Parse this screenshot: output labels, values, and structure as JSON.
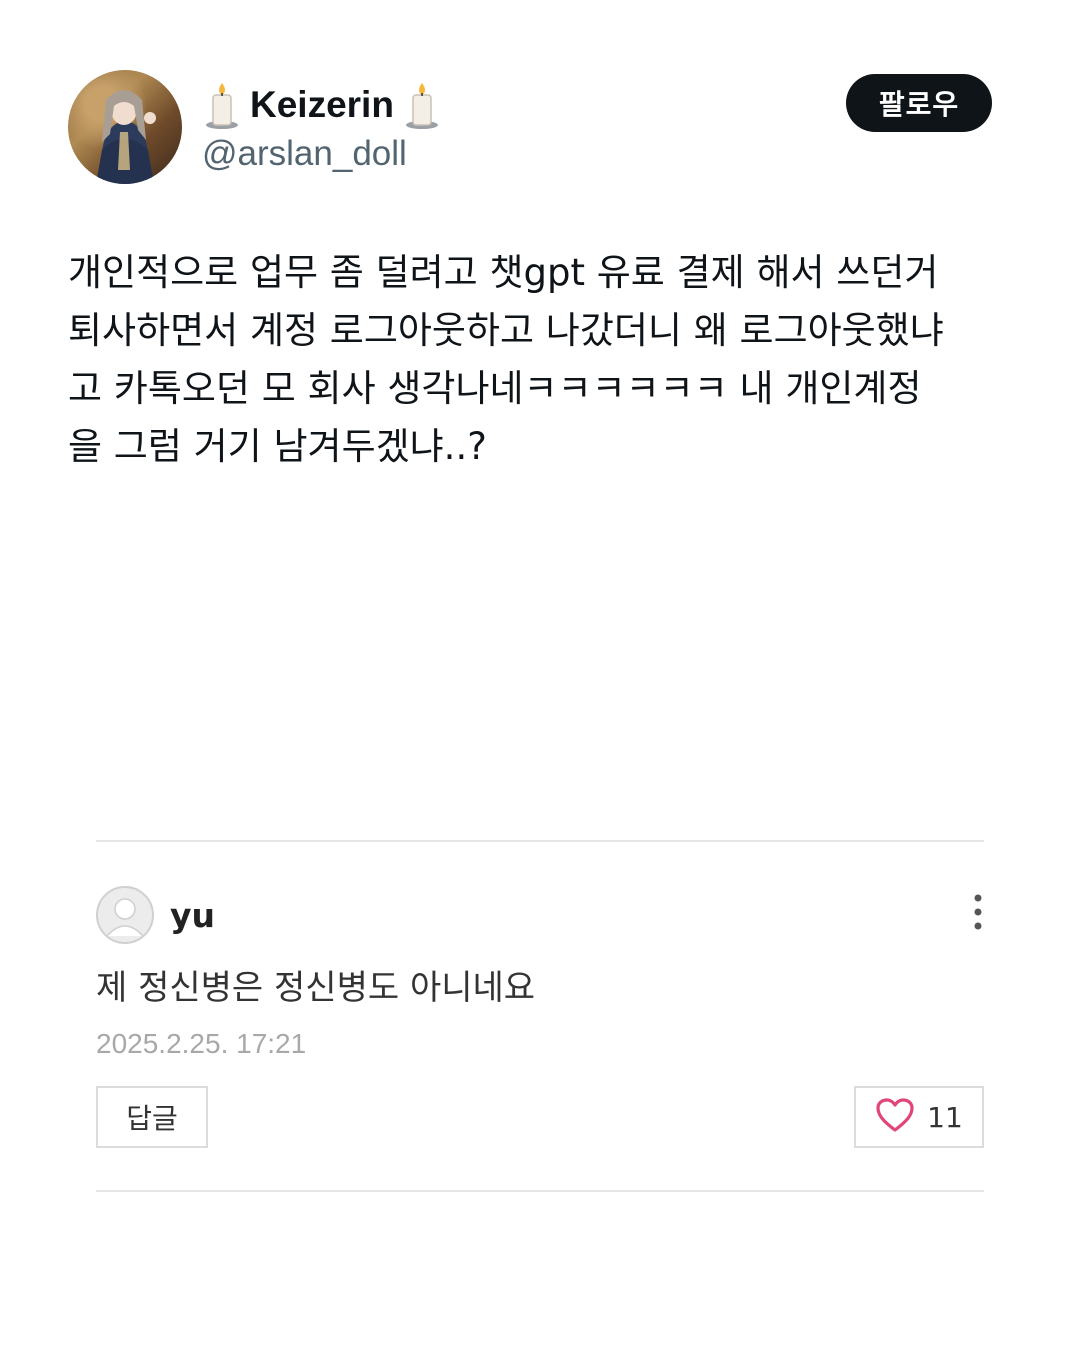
{
  "tweet": {
    "display_name": "Keizerin",
    "handle": "@arslan_doll",
    "follow_label": "팔로우",
    "text": "개인적으로 업무 좀 덜려고 챗gpt 유료 결제 해서 쓰던거\n퇴사하면서 계정 로그아웃하고 나갔더니 왜 로그아웃했냐\n고 카톡오던 모 회사 생각나네ㅋㅋㅋㅋㅋㅋ 내 개인계정\n을 그럼 거기 남겨두겠냐..?"
  },
  "comment": {
    "author": "yu",
    "text": "제 정신병은 정신병도 아니네요",
    "date": "2025.2.25. 17:21",
    "reply_label": "답글",
    "like_count": "11"
  },
  "colors": {
    "follow_bg": "#0f1419",
    "handle": "#536471",
    "heart": "#e0457b"
  },
  "icons": [
    "candle-icon",
    "more-vertical-icon",
    "heart-icon",
    "default-avatar-icon"
  ]
}
